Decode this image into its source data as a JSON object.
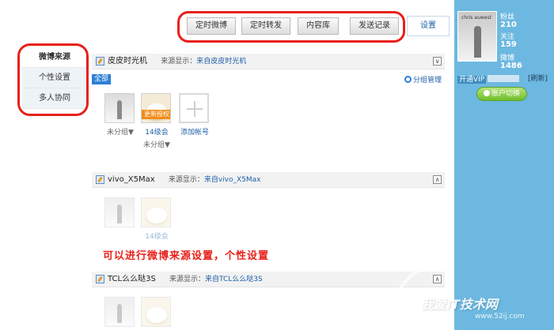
{
  "toolbar": {
    "buttons": [
      "定时微博",
      "定时转发",
      "内容库",
      "发送记录"
    ],
    "settings": "设置"
  },
  "leftnav": {
    "items": [
      "微博来源",
      "个性设置",
      "多人协同"
    ]
  },
  "sections": [
    {
      "name": "皮皮时光机",
      "source_label": "来源显示：",
      "source_value": "来自皮皮时光机",
      "toggle": "∨",
      "filter_all": "全部",
      "group_mgmt": "分组管理",
      "accounts": [
        {
          "name": "",
          "group": "未分组▼",
          "update_tag": ""
        },
        {
          "name": "14级会",
          "group": "未分组▼",
          "update_tag": "更新授权"
        },
        {
          "name": "添加帐号",
          "group": "",
          "update_tag": ""
        }
      ]
    },
    {
      "name": "vivo_X5Max",
      "source_label": "来源显示：",
      "source_value": "来自vivo_X5Max",
      "toggle": "∧",
      "accounts": [
        {
          "name": ""
        },
        {
          "name": "14级会"
        }
      ]
    },
    {
      "name": "TCL么么哒3S",
      "source_label": "来源显示：",
      "source_value": "来自TCL么么哒3S",
      "toggle": "∧"
    }
  ],
  "annotation": "可以进行微博来源设置，个性设置",
  "profile": {
    "avatar_caption": "chris auwest",
    "stats": [
      {
        "label": "粉丝",
        "value": "210"
      },
      {
        "label": "关注",
        "value": "159"
      },
      {
        "label": "微博",
        "value": "1486"
      }
    ],
    "vip": "开通VIP",
    "refresh": "[刷新]",
    "switch_account": "账户切换"
  },
  "watermark": {
    "title": "我爱IT技术网",
    "url": "www.52ij.com"
  },
  "colors": {
    "background": "#6cb8e0",
    "highlight": "#e8201a",
    "link": "#1f5fa8",
    "update_tag": "#f08c1a"
  }
}
